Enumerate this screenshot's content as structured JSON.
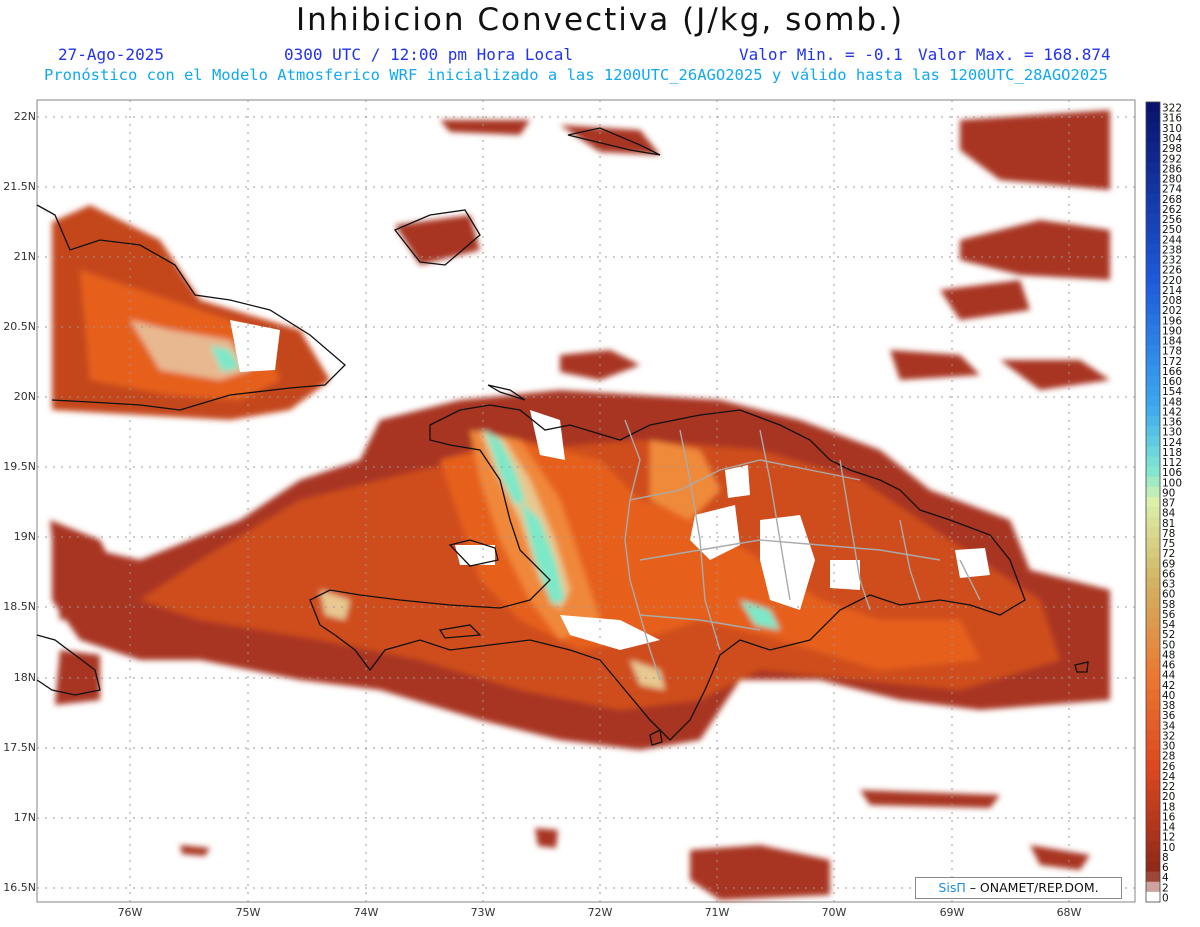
{
  "title": "Inhibicion Convectiva (J/kg, somb.)",
  "header": {
    "date": "27-Ago-2025",
    "time": "0300 UTC / 12:00 pm Hora Local",
    "min_label": "Valor Min. = -0.1",
    "max_label": "Valor Max. = 168.874",
    "subtitle": "Pronóstico con el Modelo Atmosferico WRF inicializado a las 1200UTC_26AGO2025 y válido hasta las  1200UTC_28AGO2025"
  },
  "map": {
    "lat_labels": [
      "22N",
      "21.5N",
      "21N",
      "20.5N",
      "20N",
      "19.5N",
      "19N",
      "18.5N",
      "18N",
      "17.5N",
      "17N",
      "16.5N"
    ],
    "lon_labels": [
      "76W",
      "75W",
      "74W",
      "73W",
      "72W",
      "71W",
      "70W",
      "69W",
      "68W"
    ],
    "field_colors": {
      "dark": "#9a2f1c",
      "mid": "#c94a1e",
      "orange": "#e6601f",
      "light_orange": "#f08a3a",
      "pale": "#e8c890",
      "cyan": "#7de8c8",
      "blue": "#2b4fa8"
    }
  },
  "colorbar": {
    "labels": [
      "322",
      "316",
      "310",
      "304",
      "298",
      "292",
      "286",
      "280",
      "274",
      "268",
      "262",
      "256",
      "250",
      "244",
      "238",
      "232",
      "226",
      "220",
      "214",
      "208",
      "202",
      "196",
      "190",
      "184",
      "178",
      "172",
      "166",
      "160",
      "154",
      "148",
      "142",
      "136",
      "130",
      "124",
      "118",
      "112",
      "106",
      "100",
      "90",
      "87",
      "84",
      "81",
      "78",
      "75",
      "72",
      "69",
      "66",
      "63",
      "60",
      "58",
      "56",
      "54",
      "52",
      "50",
      "48",
      "46",
      "44",
      "42",
      "40",
      "38",
      "36",
      "34",
      "32",
      "30",
      "28",
      "26",
      "24",
      "22",
      "20",
      "18",
      "16",
      "14",
      "12",
      "10",
      "8",
      "6",
      "4",
      "2",
      "0"
    ]
  },
  "credit": {
    "brand": "SisΠ",
    "text": " – ONAMET/REP.DOM."
  }
}
